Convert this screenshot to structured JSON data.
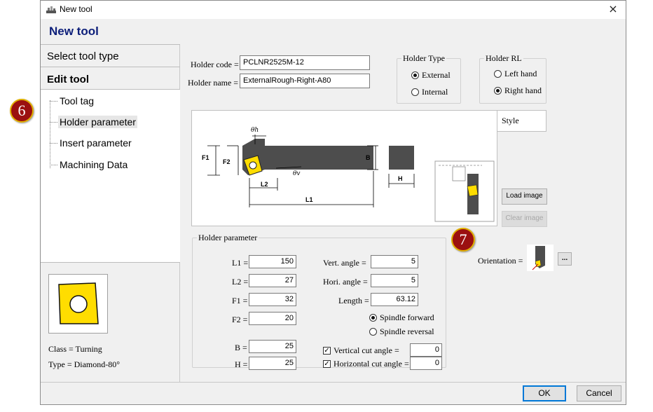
{
  "window": {
    "title": "New tool",
    "close_symbol": "×"
  },
  "header": {
    "title": "New tool"
  },
  "nav": {
    "select_tool_type": "Select tool type",
    "edit_tool": "Edit tool",
    "items": [
      {
        "label": "Tool tag",
        "selected": false
      },
      {
        "label": "Holder parameter",
        "selected": true
      },
      {
        "label": "Insert parameter",
        "selected": false
      },
      {
        "label": "Machining Data",
        "selected": false
      }
    ]
  },
  "insert_info": {
    "class_text": "Class = Turning",
    "type_text": "Type = Diamond-80°",
    "insert_color": "#ffdd00"
  },
  "form": {
    "holder_code_label": "Holder code =",
    "holder_code_value": "PCLNR2525M-12",
    "holder_name_label": "Holder name =",
    "holder_name_value": "ExternalRough-Right-A80"
  },
  "holder_type": {
    "title": "Holder Type",
    "options": [
      "External",
      "Internal"
    ],
    "selected": "External"
  },
  "holder_rl": {
    "title": "Holder RL",
    "options": [
      "Left hand",
      "Right hand"
    ],
    "selected": "Right hand"
  },
  "style_label": "Style",
  "diagram": {
    "theta_h": "θh",
    "theta_v": "θv",
    "f1": "F1",
    "f2": "F2",
    "b": "B",
    "h": "H",
    "l1": "L1",
    "l2": "L2"
  },
  "buttons": {
    "load_image": "Load image",
    "clear_image": "Clear image",
    "ok": "OK",
    "cancel": "Cancel",
    "more": "..."
  },
  "orientation_label": "Orientation =",
  "holder_parameter": {
    "title": "Holder parameter",
    "fields": {
      "l1": {
        "label": "L1 =",
        "value": "150"
      },
      "l2": {
        "label": "L2 =",
        "value": "27"
      },
      "f1": {
        "label": "F1 =",
        "value": "32"
      },
      "f2": {
        "label": "F2 =",
        "value": "20"
      },
      "b": {
        "label": "B =",
        "value": "25"
      },
      "h": {
        "label": "H =",
        "value": "25"
      },
      "vert_angle": {
        "label": "Vert. angle =",
        "value": "5"
      },
      "hori_angle": {
        "label": "Hori. angle =",
        "value": "5"
      },
      "length": {
        "label": "Length =",
        "value": "63.12"
      }
    },
    "spindle": {
      "options": [
        "Spindle forward",
        "Spindle reversal"
      ],
      "selected": "Spindle forward"
    },
    "vertical_cut": {
      "label": "Vertical cut angle =",
      "checked": true,
      "value": "0"
    },
    "horizontal_cut": {
      "label": "Horizontal cut angle =",
      "checked": true,
      "value": "0"
    }
  },
  "badges": {
    "six": "6",
    "seven": "7"
  },
  "colors": {
    "header_title": "#0d1f7a",
    "badge_fill": "#9b1010",
    "badge_ring": "#e0b000",
    "holder_body": "#4d4d4d"
  }
}
